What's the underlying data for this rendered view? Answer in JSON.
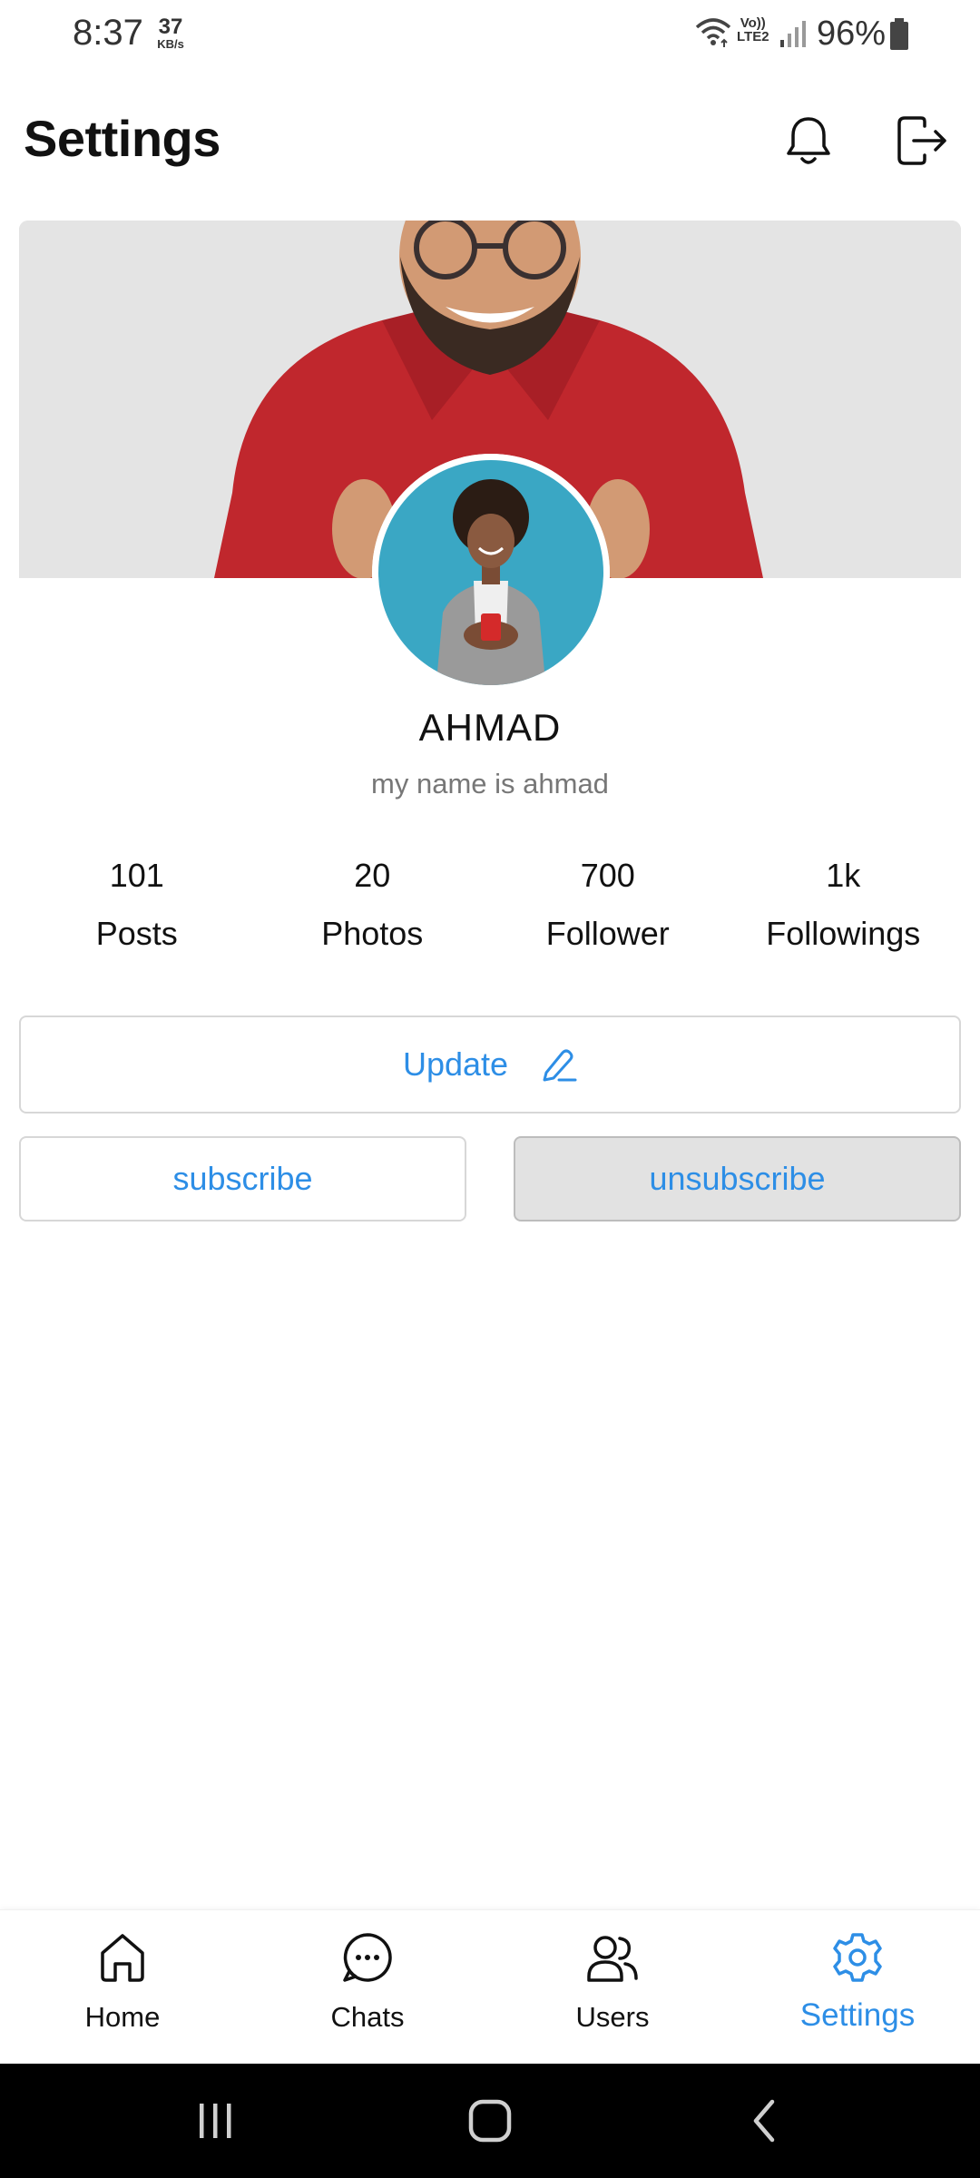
{
  "status_bar": {
    "time": "8:37",
    "net_speed_value": "37",
    "net_speed_unit": "KB/s",
    "volte_top": "Vo))",
    "volte_bottom": "LTE2",
    "battery_percent": "96%"
  },
  "header": {
    "title": "Settings",
    "icons": [
      "bell-icon",
      "logout-icon"
    ]
  },
  "profile": {
    "name": "AHMAD",
    "bio": "my name is ahmad"
  },
  "stats": [
    {
      "value": "101",
      "label": "Posts"
    },
    {
      "value": "20",
      "label": "Photos"
    },
    {
      "value": "700",
      "label": "Follower"
    },
    {
      "value": "1k",
      "label": "Followings"
    }
  ],
  "actions": {
    "update_label": "Update",
    "subscribe_label": "subscribe",
    "unsubscribe_label": "unsubscribe"
  },
  "bottom_nav": [
    {
      "label": "Home",
      "icon": "home-icon",
      "active": false
    },
    {
      "label": "Chats",
      "icon": "chat-icon",
      "active": false
    },
    {
      "label": "Users",
      "icon": "users-icon",
      "active": false
    },
    {
      "label": "Settings",
      "icon": "gear-icon",
      "active": true
    }
  ],
  "colors": {
    "accent": "#2d8ee6",
    "cover_bg": "#e4e4e4",
    "shirt": "#c0272d",
    "avatar_bg": "#3aa7c4"
  }
}
